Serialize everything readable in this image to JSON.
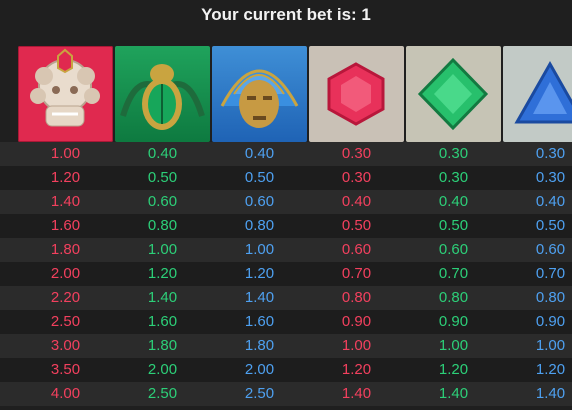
{
  "header": {
    "title": "Your current bet is: 1"
  },
  "symbols": [
    {
      "icon": "red-dragon-mask-icon",
      "color": "#e0294f"
    },
    {
      "icon": "green-scarab-icon",
      "color": "#1fa35c"
    },
    {
      "icon": "blue-tribal-mask-icon",
      "color": "#2f7ac6"
    },
    {
      "icon": "red-gem-icon",
      "color": "#e8315a"
    },
    {
      "icon": "green-gem-icon",
      "color": "#27c06c"
    },
    {
      "icon": "blue-triangle-gem-icon",
      "color": "#2f6fd8"
    }
  ],
  "paytable": {
    "rows": [
      [
        "1.00",
        "0.40",
        "0.40",
        "0.30",
        "0.30",
        "0.30"
      ],
      [
        "1.20",
        "0.50",
        "0.50",
        "0.30",
        "0.30",
        "0.30"
      ],
      [
        "1.40",
        "0.60",
        "0.60",
        "0.40",
        "0.40",
        "0.40"
      ],
      [
        "1.60",
        "0.80",
        "0.80",
        "0.50",
        "0.50",
        "0.50"
      ],
      [
        "1.80",
        "1.00",
        "1.00",
        "0.60",
        "0.60",
        "0.60"
      ],
      [
        "2.00",
        "1.20",
        "1.20",
        "0.70",
        "0.70",
        "0.70"
      ],
      [
        "2.20",
        "1.40",
        "1.40",
        "0.80",
        "0.80",
        "0.80"
      ],
      [
        "2.50",
        "1.60",
        "1.60",
        "0.90",
        "0.90",
        "0.90"
      ],
      [
        "3.00",
        "1.80",
        "1.80",
        "1.00",
        "1.00",
        "1.00"
      ],
      [
        "3.50",
        "2.00",
        "2.00",
        "1.20",
        "1.20",
        "1.20"
      ],
      [
        "4.00",
        "2.50",
        "2.50",
        "1.40",
        "1.40",
        "1.40"
      ]
    ]
  }
}
